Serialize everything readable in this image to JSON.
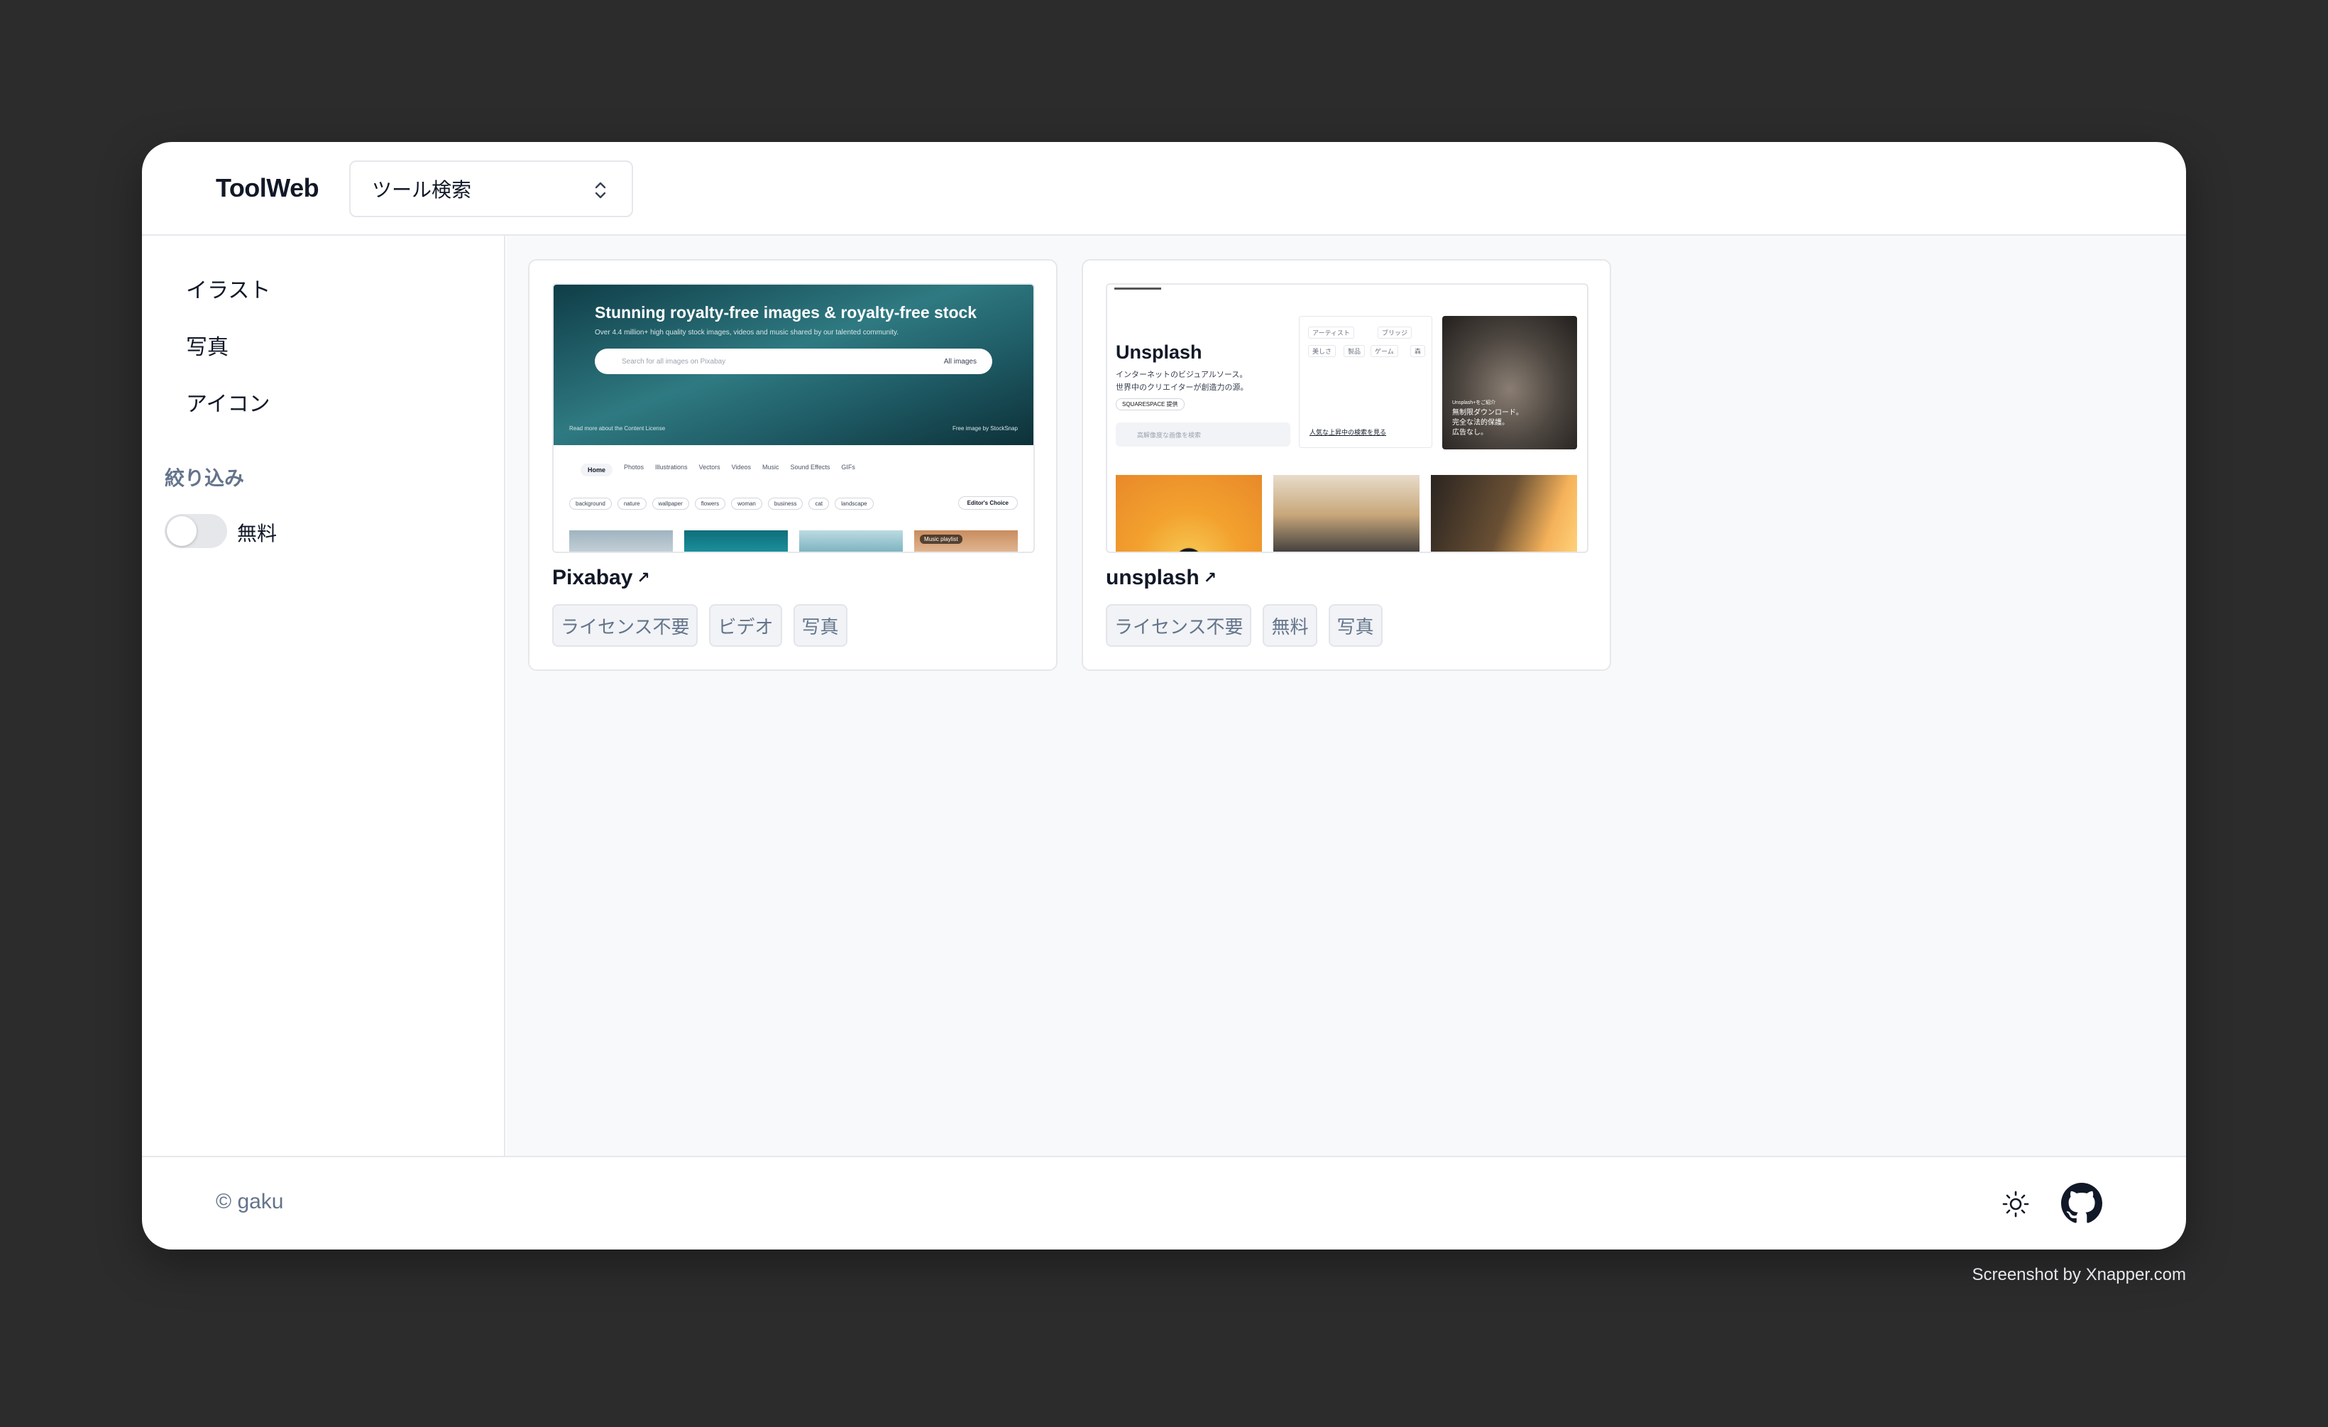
{
  "header": {
    "logo": "ToolWeb",
    "search_select_value": "ツール検索"
  },
  "sidebar": {
    "items": [
      {
        "label": "イラスト"
      },
      {
        "label": "写真"
      },
      {
        "label": "アイコン"
      }
    ],
    "filter_title": "絞り込み",
    "toggle_label": "無料",
    "toggle_on": false
  },
  "cards": [
    {
      "title": "Pixabay",
      "tags": [
        "ライセンス不要",
        "ビデオ",
        "写真"
      ],
      "preview": {
        "headline": "Stunning royalty-free images & royalty-free stock",
        "subtitle": "Over 4.4 million+ high quality stock images, videos and music shared by our talented community.",
        "search_placeholder": "Search for all images on Pixabay",
        "search_scope": "All images",
        "footer_left": "Read more about the Content License",
        "footer_right": "Free image by StockSnap",
        "tabs": [
          "Home",
          "Photos",
          "Illustrations",
          "Vectors",
          "Videos",
          "Music",
          "Sound Effects",
          "GIFs"
        ],
        "chips": [
          "background",
          "nature",
          "wallpaper",
          "flowers",
          "woman",
          "business",
          "cat",
          "landscape"
        ],
        "editor_choice": "Editor's Choice",
        "music_badge": "Music playlist"
      }
    },
    {
      "title": "unsplash",
      "tags": [
        "ライセンス不要",
        "無料",
        "写真"
      ],
      "preview": {
        "brand": "Unsplash",
        "desc_line1": "インターネットのビジュアルソース。",
        "desc_line2": "世界中のクリエイターが創造力の源。",
        "badge": "SQUARESPACE 提供",
        "search_placeholder": "高解像度な画像を検索",
        "chips": [
          "アーティスト",
          "ブリッジ",
          "美しさ",
          "製品",
          "ゲーム",
          "森"
        ],
        "trending": "人気な上昇中の検索を見る",
        "photo_caption_1": "Unsplash+をご紹介",
        "photo_caption_2": "無制限ダウンロード。",
        "photo_caption_3": "完全な法的保護。",
        "photo_caption_4": "広告なし。"
      }
    }
  ],
  "footer": {
    "copyright": "© gaku"
  },
  "credit": "Screenshot by Xnapper.com",
  "colors": {
    "background": "#2c2c2c",
    "window": "#ffffff",
    "main_bg": "#f8f9fb",
    "muted_text": "#64748b",
    "tag_bg": "#f1f3f6"
  },
  "icons": {
    "select": "chevron-up-down-icon",
    "theme": "sun-icon",
    "github": "github-icon",
    "external": "external-link-icon"
  }
}
